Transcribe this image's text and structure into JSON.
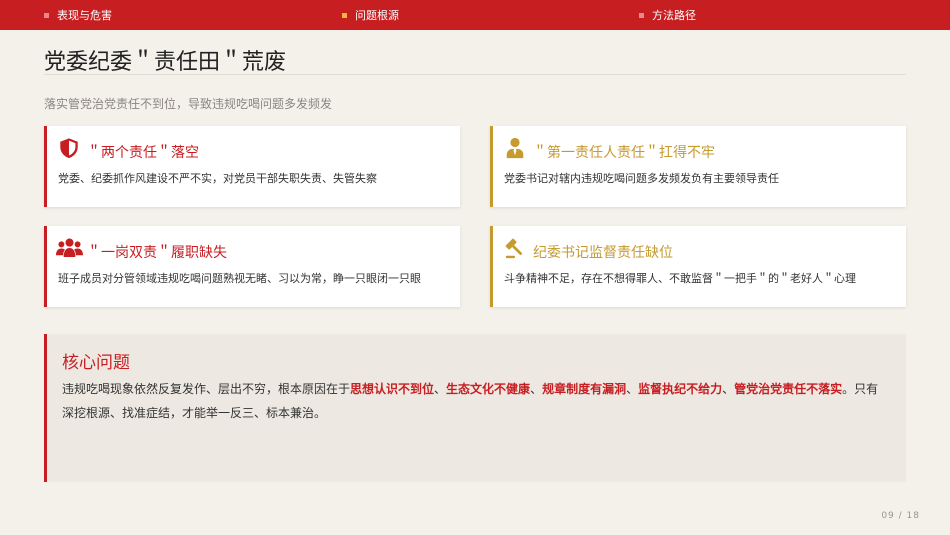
{
  "nav": {
    "items": [
      {
        "label": "表现与危害",
        "dot_color": "#e8888a"
      },
      {
        "label": "问题根源",
        "dot_color": "#f0b640"
      },
      {
        "label": "方法路径",
        "dot_color": "#e8888a"
      }
    ]
  },
  "page": {
    "title": "党委纪委＂责任田＂荒废",
    "subtitle": "落实管党治党责任不到位，导致违规吃喝问题多发频发"
  },
  "cards": [
    {
      "icon": "shield-icon",
      "color": "#c71e22",
      "head": "＂两个责任＂落空",
      "body": "党委、纪委抓作风建设不严不实，对党员干部失职失责、失管失察"
    },
    {
      "icon": "user-tie-icon",
      "color": "#c59a2f",
      "head": "＂第一责任人责任＂扛得不牢",
      "body": "党委书记对辖内违规吃喝问题多发频发负有主要领导责任"
    },
    {
      "icon": "users-icon",
      "color": "#c71e22",
      "head": "＂一岗双责＂履职缺失",
      "body": "班子成员对分管领域违规吃喝问题熟视无睹、习以为常，睁一只眼闭一只眼"
    },
    {
      "icon": "gavel-icon",
      "color": "#c59a2f",
      "head": "纪委书记监督责任缺位",
      "body": "斗争精神不足，存在不想得罪人、不敢监督＂一把手＂的＂老好人＂心理"
    }
  ],
  "core": {
    "head": "核心问题",
    "text_prefix": "违规吃喝现象依然反复发作、层出不穷，根本原因在于",
    "highlights": [
      "思想认识不到位",
      "生态文化不健康",
      "规章制度有漏洞",
      "监督执纪不给力",
      "管党治党责任不落实"
    ],
    "sep": "、",
    "period": "。",
    "text_suffix": "只有深挖根源、找准症结，才能举一反三、标本兼治。"
  },
  "page_number": "09 / 18",
  "colors": {
    "accent_red": "#c71e22",
    "accent_gold": "#c59a2f",
    "background": "#f4f1eb"
  }
}
